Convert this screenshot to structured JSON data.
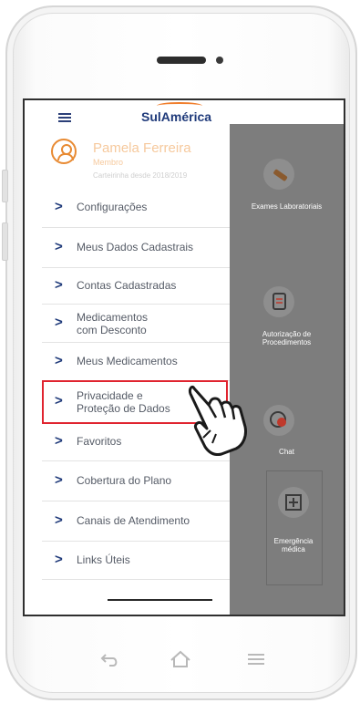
{
  "app": {
    "brand": "SulAmérica"
  },
  "profile": {
    "name": "Pamela Ferreira",
    "subtitle": "Membro",
    "meta": "Carteirinha desde 2018/2019"
  },
  "menu": [
    {
      "label": "Configurações"
    },
    {
      "label": "Meus Dados Cadastrais"
    },
    {
      "label": "Contas Cadastradas"
    },
    {
      "label": "Medicamentos\ncom Desconto"
    },
    {
      "label": "Meus Medicamentos"
    },
    {
      "label": "Privacidade e\nProteção de Dados"
    },
    {
      "label": "Favoritos"
    },
    {
      "label": "Cobertura do Plano"
    },
    {
      "label": "Canais de Atendimento"
    },
    {
      "label": "Links Úteis"
    }
  ],
  "background_shortcuts": [
    {
      "label": "Exames Laboratoriais",
      "icon": "test-tube-icon"
    },
    {
      "label": "Autorização de\nProcedimentos",
      "icon": "document-icon"
    },
    {
      "label": "Chat",
      "icon": "chat-icon"
    },
    {
      "label": "Emergência\nmédica",
      "icon": "hospital-icon"
    }
  ],
  "colors": {
    "brand_blue": "#1f3a7a",
    "accent_orange": "#e88a32",
    "highlight_red": "#e0242f",
    "overlay_gray": "#7d7d7d"
  },
  "android_nav": {
    "back_icon": "back-arrow-icon",
    "home_icon": "home-icon",
    "menu_icon": "recent-apps-icon"
  }
}
